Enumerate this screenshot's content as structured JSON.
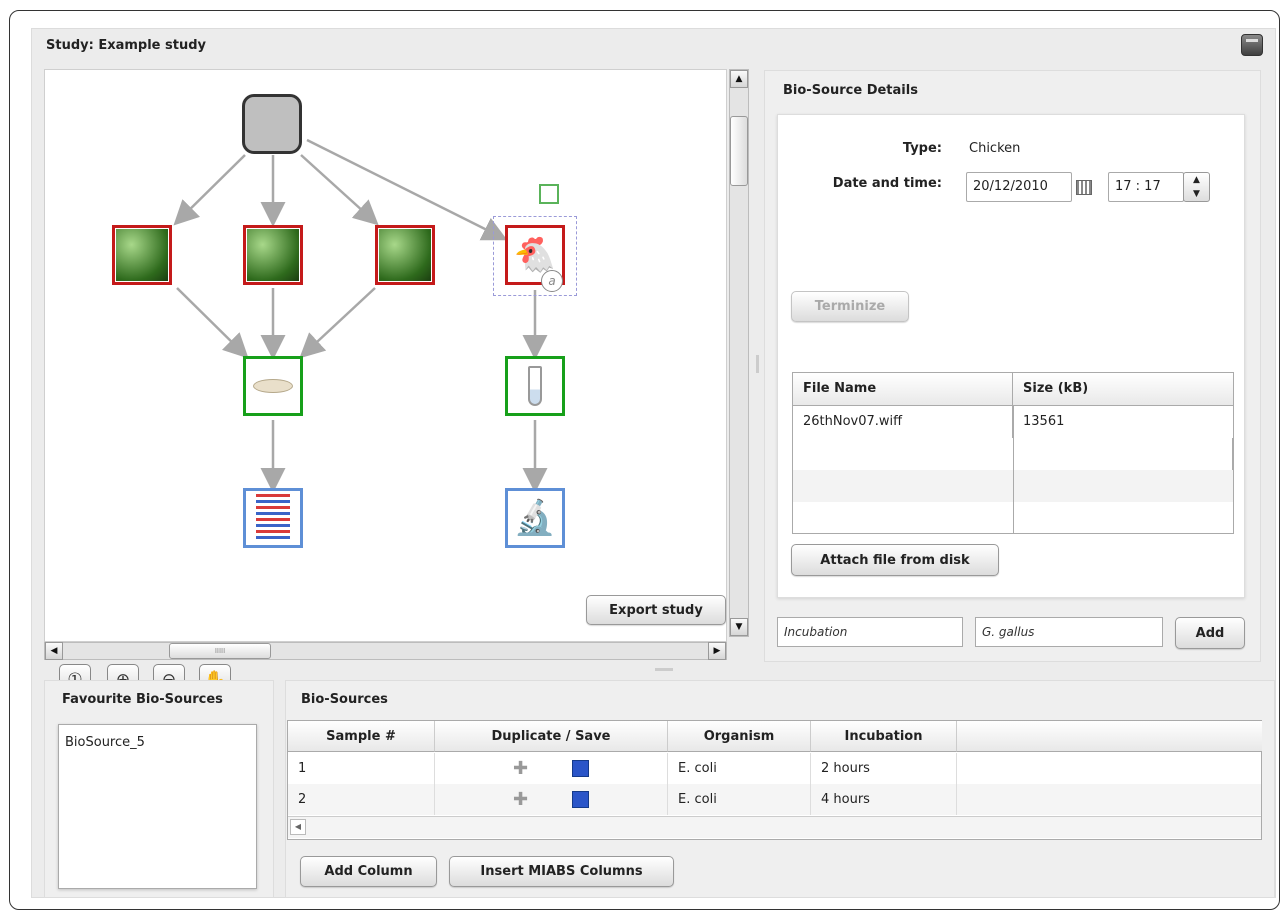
{
  "study": {
    "title": "Study: Example study"
  },
  "canvas": {
    "export_label": "Export study",
    "scroll_grip": "IIIII"
  },
  "details": {
    "title": "Bio-Source Details",
    "type_label": "Type:",
    "type_value": "Chicken",
    "datetime_label": "Date and time:",
    "date_value": "20/12/2010",
    "time_value": "17 : 17",
    "terminize_label": "Terminize",
    "files": {
      "columns": [
        "File Name",
        "Size (kB)"
      ],
      "rows": [
        {
          "name": "26thNov07.wiff",
          "size": "13561"
        }
      ]
    },
    "attach_label": "Attach file from disk"
  },
  "add_row": {
    "field1_value": "Incubation",
    "field2_value": "G. gallus",
    "add_label": "Add"
  },
  "favourites": {
    "title": "Favourite Bio-Sources",
    "items": [
      "BioSource_5"
    ]
  },
  "biosources": {
    "title": "Bio-Sources",
    "columns": [
      "Sample #",
      "Duplicate / Save",
      "Organism",
      "Incubation"
    ],
    "rows": [
      {
        "sample": "1",
        "organism": "E. coli",
        "incubation": "2 hours"
      },
      {
        "sample": "2",
        "organism": "E. coli",
        "incubation": "4 hours"
      }
    ],
    "add_column_label": "Add Column",
    "insert_miabs_label": "Insert MIABS Columns"
  },
  "colors": {
    "bio_source_border": "#c41a1a",
    "sample_border": "#17a01a",
    "data_border": "#5e8fd6",
    "edge": "#a8a8a8"
  }
}
